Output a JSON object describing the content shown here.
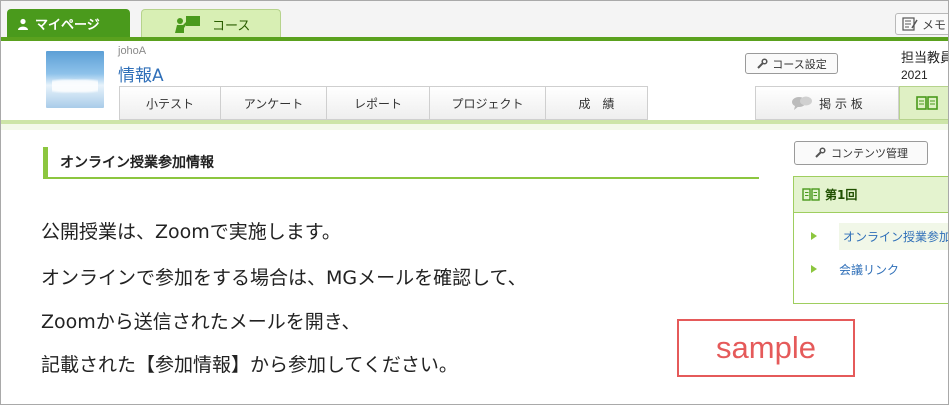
{
  "topbar": {
    "mypage_tab": "マイページ",
    "course_tab": "コース",
    "memo_tab": "メモ"
  },
  "course": {
    "code": "johoA",
    "name": "情報A",
    "settings_button": "コース設定",
    "teacher_label": "担当教員",
    "year": "2021"
  },
  "subnav": {
    "items": [
      "小テスト",
      "アンケート",
      "レポート",
      "プロジェクト",
      "成　績"
    ],
    "board": "掲 示 板"
  },
  "main": {
    "section_title": "オンライン授業参加情報",
    "lines": [
      "公開授業は、Zoomで実施します。",
      "オンラインで参加をする場合は、MGメールを確認して、",
      "Zoomから送信されたメールを開き、",
      "記載された【参加情報】から参加してください。"
    ],
    "sample_label": "sample"
  },
  "side": {
    "contents_button": "コンテンツ管理",
    "heading": "第1回",
    "items": [
      "オンライン授業参加情報",
      "会議リンク"
    ]
  },
  "colors": {
    "brand_green": "#4a9a1c",
    "accent_green": "#8cc63f",
    "link_blue": "#2f6fb8",
    "sample_red": "#e55a5a"
  }
}
